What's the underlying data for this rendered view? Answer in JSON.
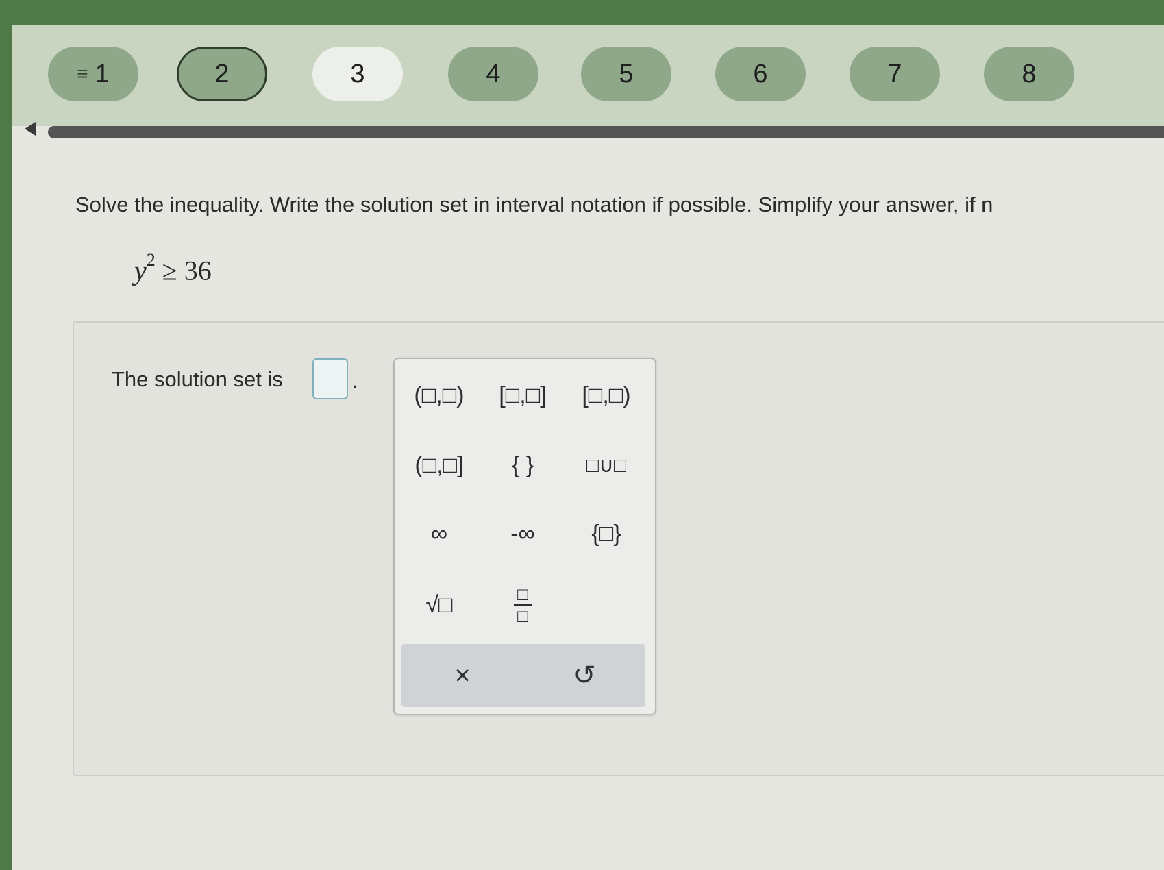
{
  "nav": {
    "questions": [
      {
        "label": "1",
        "state": "flagged"
      },
      {
        "label": "2",
        "state": "current"
      },
      {
        "label": "3",
        "state": "active"
      },
      {
        "label": "4",
        "state": "normal"
      },
      {
        "label": "5",
        "state": "normal"
      },
      {
        "label": "6",
        "state": "normal"
      },
      {
        "label": "7",
        "state": "normal"
      },
      {
        "label": "8",
        "state": "normal"
      }
    ],
    "menu_icon": "list-icon"
  },
  "question": {
    "instruction": "Solve the inequality. Write the solution set in interval notation if possible. Simplify your answer, if n",
    "var": "y",
    "exp": "2",
    "rest": "≥ 36"
  },
  "answer": {
    "label": "The solution set is",
    "period": "."
  },
  "palette": {
    "buttons": [
      {
        "id": "open-open",
        "text": "(□,□)"
      },
      {
        "id": "closed-closed",
        "text": "[□,□]"
      },
      {
        "id": "closed-open",
        "text": "[□,□)"
      },
      {
        "id": "open-closed",
        "text": "(□,□]"
      },
      {
        "id": "empty-set",
        "text": "{ }"
      },
      {
        "id": "union",
        "text": "□∪□"
      },
      {
        "id": "infinity",
        "text": "∞"
      },
      {
        "id": "neg-infinity",
        "text": "-∞"
      },
      {
        "id": "set-braces",
        "text": "{□}"
      },
      {
        "id": "sqrt",
        "text": "√□"
      },
      {
        "id": "fraction",
        "num": "□",
        "den": "□"
      }
    ],
    "clear": "×",
    "undo": "↺"
  },
  "colors": {
    "top_bar": "#4f7a48",
    "nav_bg": "#c9d4c1",
    "pill": "#8fa88a",
    "input_border": "#7fb1bd"
  }
}
